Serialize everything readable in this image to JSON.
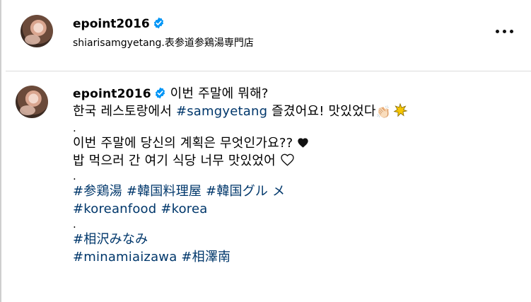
{
  "header": {
    "username": "epoint2016",
    "location": "shiarisamgyetang.表参道参鶏湯専門店"
  },
  "caption": {
    "username": "epoint2016",
    "line1": "이번 주말에 뭐해?",
    "line2_pre": "한국 레스토랑에서 ",
    "line2_tag": "#samgyetang",
    "line2_post": " 즐겼어요! 맛있었다",
    "dot1": ".",
    "line3": "이번 주말에 당신의 계획은 무엇인가요?? ",
    "line4": "밥 먹으러 간 여기 식당 너무 맛있었어 ",
    "dot2": ".",
    "hashtags_1": [
      "#参鶏湯",
      "#韓国料理屋",
      "#韓国グル メ"
    ],
    "hashtags_2": [
      "#koreanfood",
      "#korea"
    ],
    "dot3": ".",
    "hashtags_3": [
      "#相沢みなみ"
    ],
    "hashtags_4": [
      "#minamiaizawa",
      "#相澤南"
    ]
  },
  "colors": {
    "verified": "#0095f6",
    "hashtag": "#00376b",
    "divider": "#dbdbdb"
  },
  "icons": [
    "verified-badge-icon",
    "more-options-icon",
    "clapping-hands-emoji",
    "sparkle-emoji",
    "black-heart-emoji",
    "white-heart-emoji"
  ]
}
